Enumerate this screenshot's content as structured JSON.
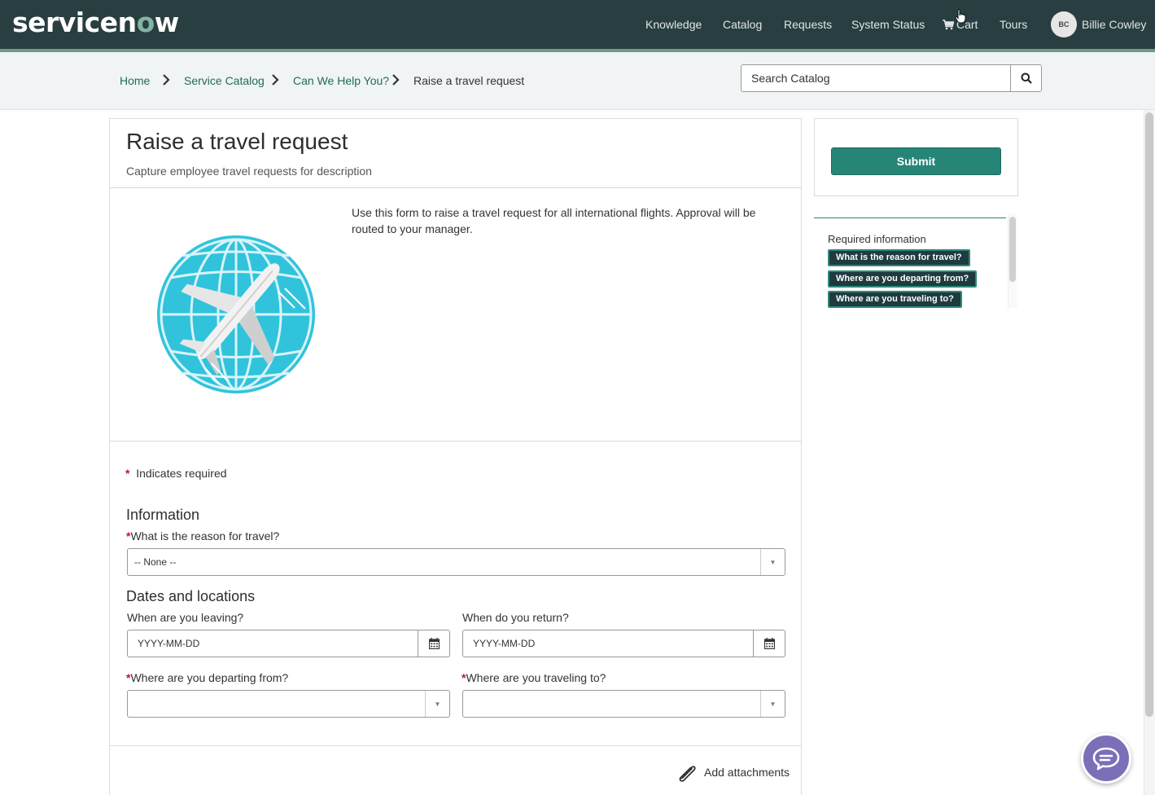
{
  "header": {
    "logo_text_a": "servicen",
    "logo_text_o": "o",
    "logo_text_b": "w",
    "nav": [
      "Knowledge",
      "Catalog",
      "Requests",
      "System Status",
      "Cart",
      "Tours"
    ],
    "user_initials": "BC",
    "user_name": "Billie Cowley"
  },
  "breadcrumb": [
    "Home",
    "Service Catalog",
    "Can We Help You?",
    "Raise a travel request"
  ],
  "search": {
    "value": "Search Catalog"
  },
  "item": {
    "title": "Raise a travel request",
    "subtitle": "Capture employee travel requests for description",
    "description": "Use this form to raise a travel request for all international flights. Approval will be routed to your manager."
  },
  "form": {
    "required_marker": "*",
    "required_note": "Indicates required",
    "section_information": "Information",
    "reason_label": "What is the reason for travel?",
    "reason_value": "-- None --",
    "section_dates": "Dates and locations",
    "leaving_label": "When are you leaving?",
    "leaving_value": "YYYY-MM-DD",
    "return_label": "When do you return?",
    "return_value": "YYYY-MM-DD",
    "departing_label": "Where are you departing from?",
    "departing_value": "",
    "destination_label": "Where are you traveling to?",
    "destination_value": "",
    "attachments_label": "Add attachments"
  },
  "sidebar": {
    "submit_label": "Submit",
    "required_title": "Required information",
    "required_items": [
      "What is the reason for travel?",
      "Where are you departing from?",
      "Where are you traveling to?"
    ]
  },
  "colors": {
    "header_bg": "#293e40",
    "brand_green": "#81b5a1",
    "submit_bg": "#278577",
    "required_star": "#c8102e",
    "tag_bg": "#1e3b3f",
    "globe": "#31c3dc",
    "chat_bg": "#7c6fb8"
  },
  "icons": {
    "cart": "cart-icon",
    "search": "search-icon",
    "calendar": "calendar-icon",
    "attachment": "paperclip-icon",
    "chat": "chat-icon",
    "item_image": "globe-airplane-icon"
  }
}
